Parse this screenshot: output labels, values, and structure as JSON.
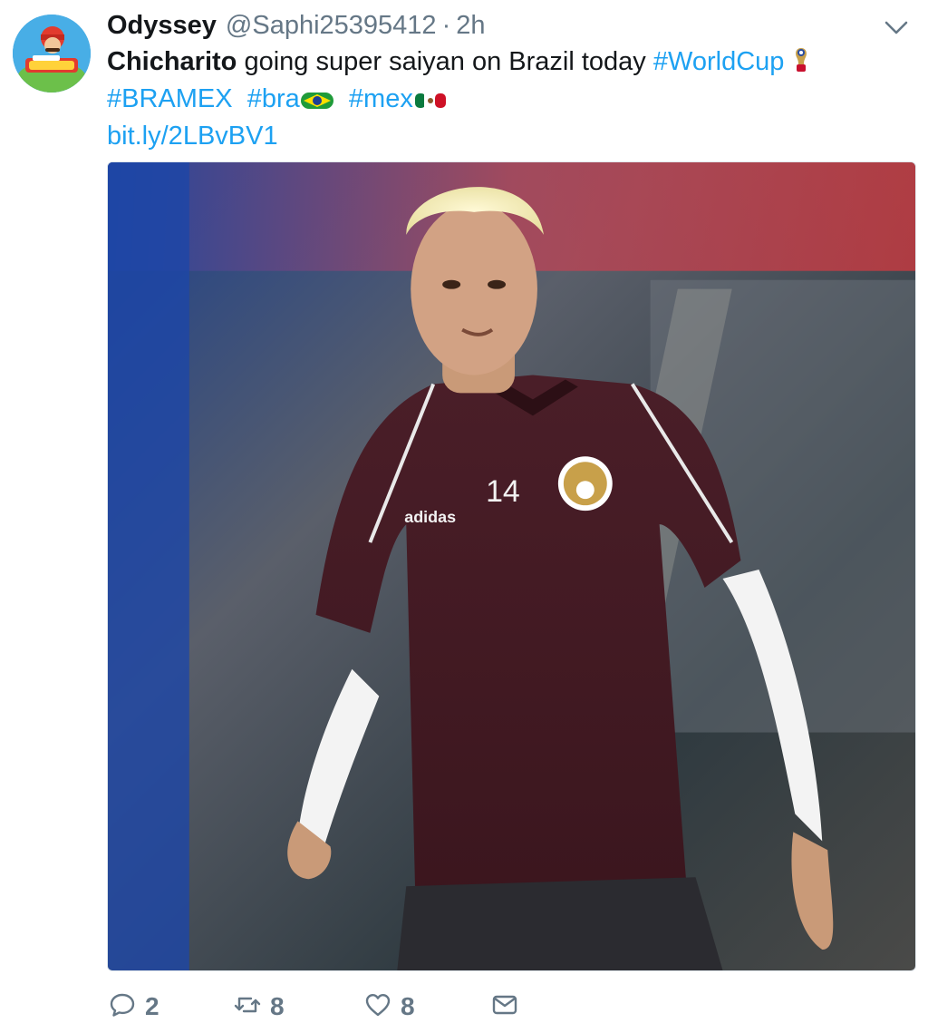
{
  "tweet": {
    "author_name": "Odyssey",
    "author_handle": "@Saphi25395412",
    "separator": "·",
    "time": "2h",
    "text_bold": "Chicharito",
    "text_rest": " going super saiyan on Brazil today ",
    "hashtag_worldcup": "#WorldCup",
    "hashtag_bramex": "#BRAMEX",
    "hashtag_bra": "#bra",
    "hashtag_mex": "#mex",
    "link": "bit.ly/2LBvBV1",
    "jersey_number": "14",
    "jersey_brand": "adidas"
  },
  "actions": {
    "reply_count": "2",
    "retweet_count": "8",
    "like_count": "8"
  },
  "icons": {
    "avatar": "super-mario-odyssey-avatar",
    "caret": "chevron-down-icon",
    "reply": "reply-icon",
    "retweet": "retweet-icon",
    "like": "heart-icon",
    "dm": "envelope-icon",
    "brazil_flag": "brazil-flag-emoji",
    "mexico_flag": "mexico-flag-emoji",
    "worldcup_trophy": "world-cup-emoji"
  },
  "colors": {
    "link_blue": "#1da1f2",
    "secondary_text": "#657786",
    "primary_text": "#14171a"
  }
}
